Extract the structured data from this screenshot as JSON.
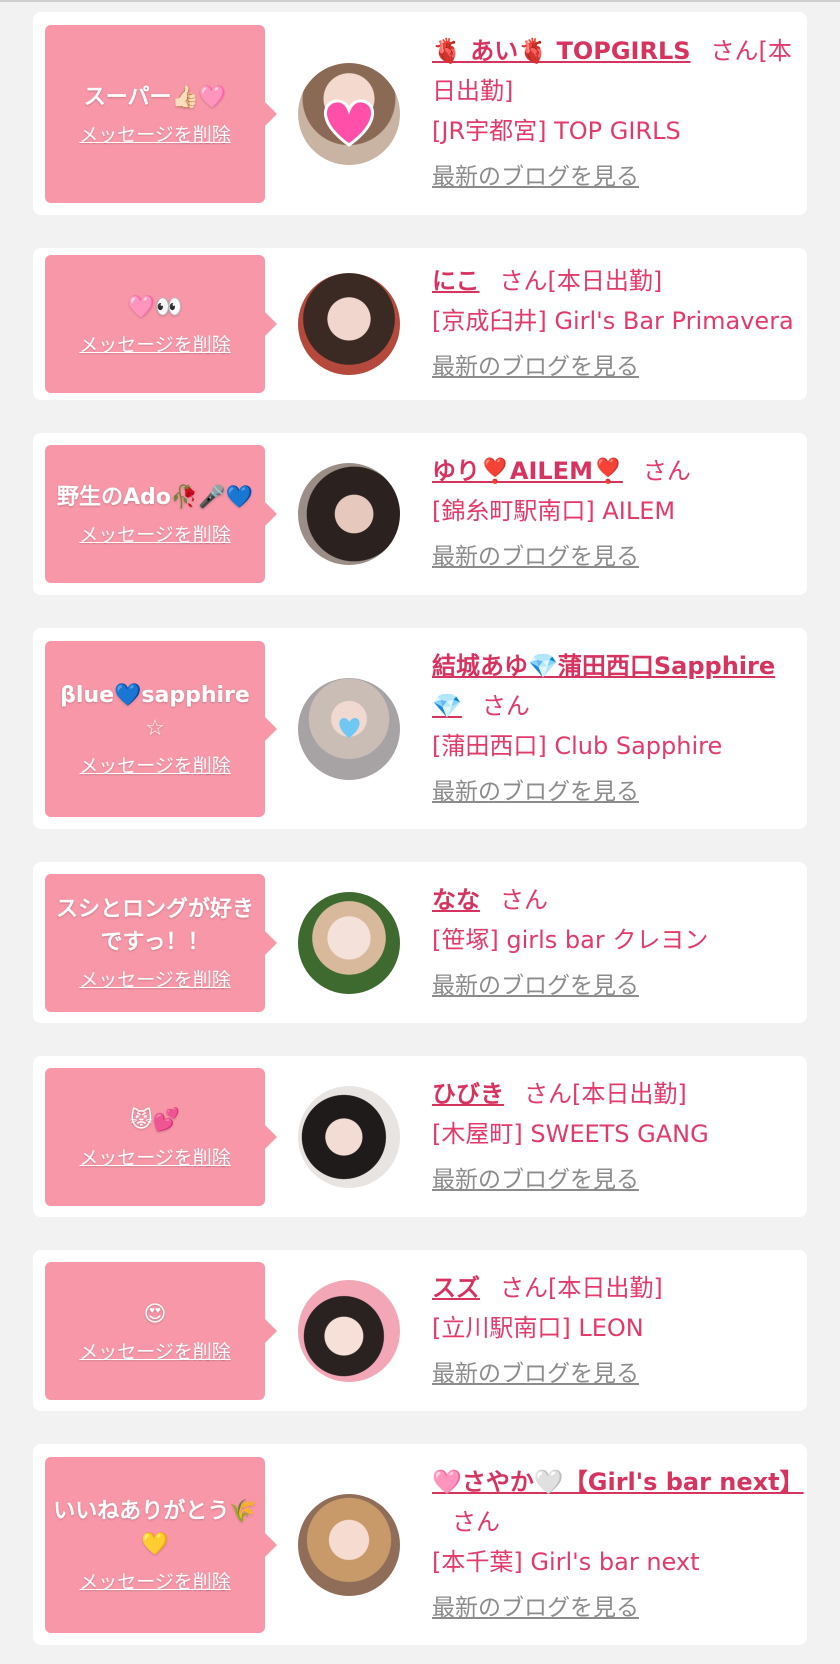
{
  "delete_label": "メッセージを削除",
  "blog_label": "最新のブログを見る",
  "colors": {
    "bubble": "#f797a8",
    "accent": "#d7335f",
    "link_gray": "#8c8c8c"
  },
  "items": [
    {
      "message": "スーパー👍🏻🩷",
      "name": "🫀 あい🫀 TOPGIRLS",
      "suffix": "さん[本日出勤]",
      "shop": "[JR宇都宮] TOP GIRLS"
    },
    {
      "message": "🩷👀",
      "name": "にこ",
      "suffix": "さん[本日出勤]",
      "shop": "[京成臼井] Girl's Bar Primavera"
    },
    {
      "message": "野生のAdo🥀🎤💙",
      "name": "ゆり❣️AILEM❣️",
      "suffix": "さん",
      "shop": "[錦糸町駅南口] AILEM"
    },
    {
      "message": "βlue💙sapphire☆",
      "name": "結城あゆ💎蒲田西口Sapphire💎",
      "suffix": "さん",
      "shop": "[蒲田西口] Club Sapphire"
    },
    {
      "message": "スシとロングが好きですっ！！",
      "name": "なな",
      "suffix": "さん",
      "shop": "[笹塚] girls bar クレヨン"
    },
    {
      "message": "😾💕",
      "name": "ひびき",
      "suffix": "さん[本日出勤]",
      "shop": "[木屋町] SWEETS GANG"
    },
    {
      "message": "😍",
      "name": "スズ",
      "suffix": "さん[本日出勤]",
      "shop": "[立川駅南口] LEON"
    },
    {
      "message": "いいねありがとう🌾💛",
      "name": "🩷さやか🤍【Girl's bar next】",
      "suffix": "さん",
      "shop": "[本千葉] Girl's bar next"
    }
  ]
}
